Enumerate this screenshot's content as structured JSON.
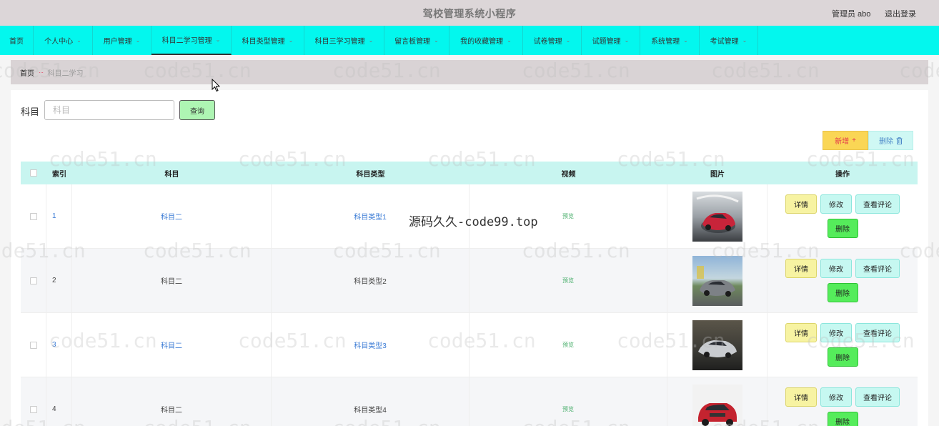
{
  "header": {
    "title": "驾校管理系统小程序",
    "user": "管理员 abo",
    "logout": "退出登录"
  },
  "nav": {
    "items": [
      {
        "label": "首页",
        "has_dropdown": false
      },
      {
        "label": "个人中心",
        "has_dropdown": true
      },
      {
        "label": "用户管理",
        "has_dropdown": true
      },
      {
        "label": "科目二学习管理",
        "has_dropdown": true,
        "active": true
      },
      {
        "label": "科目类型管理",
        "has_dropdown": true
      },
      {
        "label": "科目三学习管理",
        "has_dropdown": true
      },
      {
        "label": "留言板管理",
        "has_dropdown": true
      },
      {
        "label": "我的收藏管理",
        "has_dropdown": true
      },
      {
        "label": "试卷管理",
        "has_dropdown": true
      },
      {
        "label": "试题管理",
        "has_dropdown": true
      },
      {
        "label": "系统管理",
        "has_dropdown": true
      },
      {
        "label": "考试管理",
        "has_dropdown": true
      }
    ]
  },
  "breadcrumb": {
    "home": "首页",
    "separator": "···",
    "current": "科目二学习"
  },
  "search": {
    "label": "科目",
    "placeholder": "科目",
    "value": "",
    "button": "查询"
  },
  "toolbar": {
    "add_label": "新增",
    "add_icon": "+",
    "delete_label": "删除",
    "delete_icon": "trash-icon"
  },
  "table": {
    "headers": {
      "index": "索引",
      "subject": "科目",
      "subject_type": "科目类型",
      "video": "视频",
      "image": "图片",
      "actions": "操作"
    },
    "rows": [
      {
        "index": "1",
        "subject": "科目二",
        "subject_type": "科目类型1",
        "video": "预览",
        "image": "red-car-photo"
      },
      {
        "index": "2",
        "subject": "科目二",
        "subject_type": "科目类型2",
        "video": "预览",
        "image": "gray-sedan-photo"
      },
      {
        "index": "3",
        "subject": "科目二",
        "subject_type": "科目类型3",
        "video": "预览",
        "image": "silver-sports-car-photo"
      },
      {
        "index": "4",
        "subject": "科目二",
        "subject_type": "科目类型4",
        "video": "预览",
        "image": "red-suv-photo"
      }
    ],
    "row_actions": {
      "detail": "详情",
      "edit": "修改",
      "comments": "查看评论",
      "delete": "删除"
    }
  },
  "watermark": {
    "text": "code51.cn"
  },
  "overlay": {
    "text": "源码久久-code99.top"
  },
  "colors": {
    "nav_bg": "#03f7ee",
    "header_bg": "#dcd6d8",
    "table_head_bg": "#c8f5f0",
    "add_button": "#fad655",
    "delete_button": "#55ec5b"
  }
}
